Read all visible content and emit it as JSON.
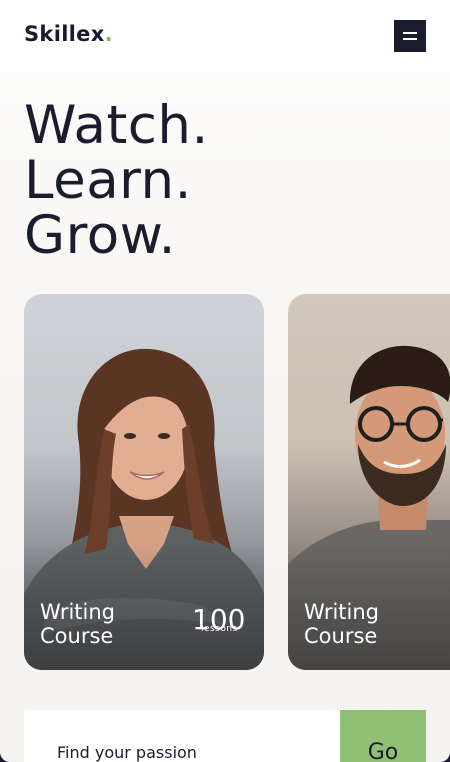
{
  "brand": {
    "name": "Skillex",
    "dot": "."
  },
  "header": {
    "menu_icon": "hamburger-icon"
  },
  "hero": {
    "lines": [
      "Watch.",
      "Learn.",
      "Grow."
    ]
  },
  "cards": [
    {
      "title": "Writing Course",
      "count": "100",
      "count_label": "lessons"
    },
    {
      "title": "Writing Course"
    }
  ],
  "search": {
    "placeholder": "Find your passion",
    "button_label": "Go"
  },
  "colors": {
    "dark": "#1b1d2e",
    "accent": "#8fc076",
    "logo_dot": "#7bbf61"
  }
}
